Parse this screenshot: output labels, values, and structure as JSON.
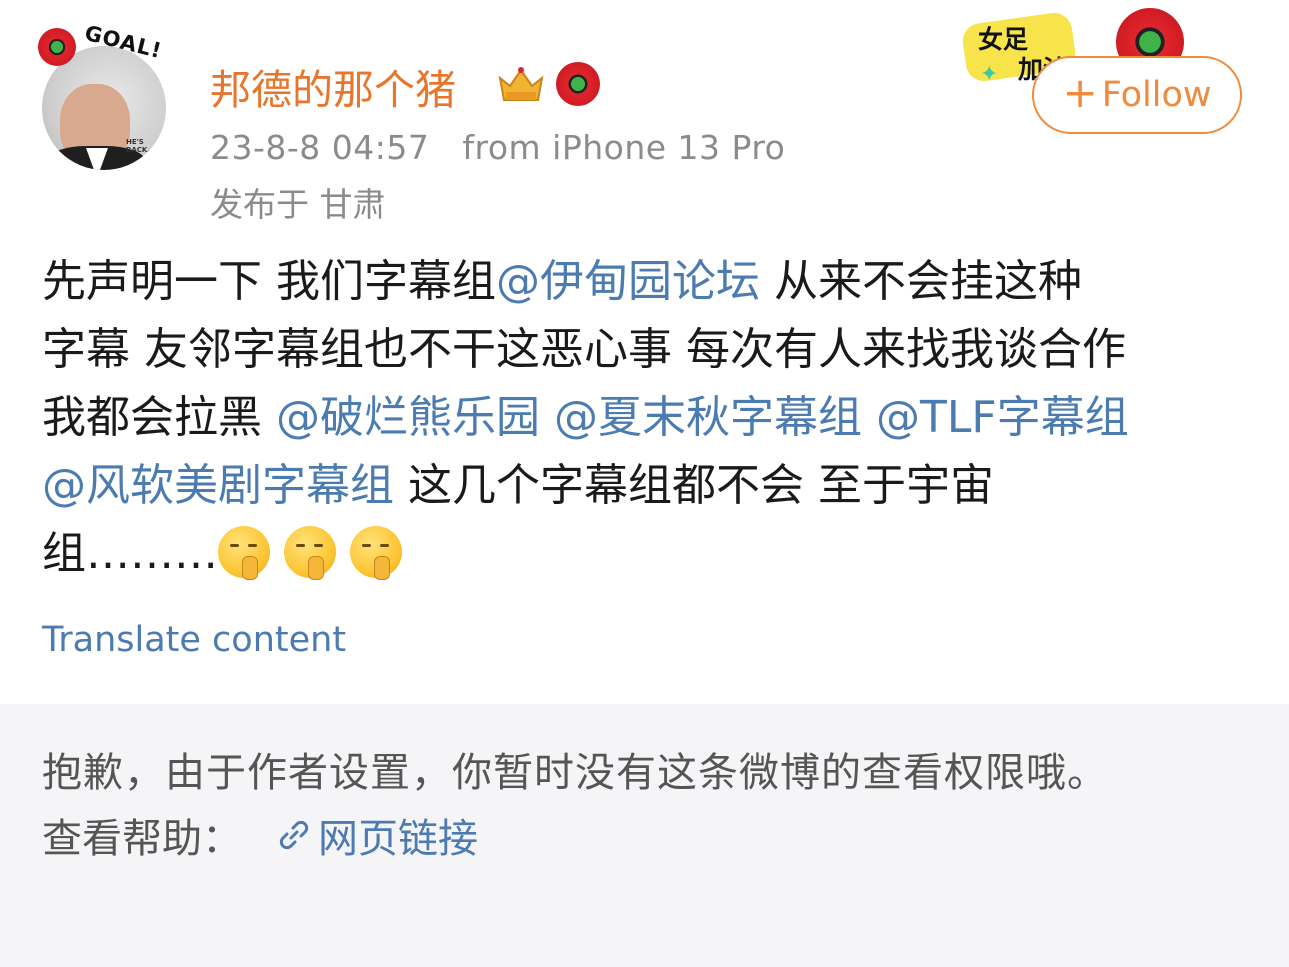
{
  "user": {
    "name": "邦德的那个猪",
    "avatar_badge_text": "GOAL!",
    "avatar_caption": "HE'S BACK.",
    "meta_time": "23-8-8 04:57",
    "meta_source": "from iPhone 13 Pro",
    "meta_location": "发布于 甘肃"
  },
  "sticker": {
    "line1": "女足",
    "line2": "加油"
  },
  "follow": {
    "plus": "+",
    "label": "Follow"
  },
  "post": {
    "lines": [
      [
        {
          "text": "先声明一下 我们字幕组"
        },
        {
          "text": "@伊甸园论坛",
          "mention": true
        },
        {
          "text": " 从来不会挂这种"
        }
      ],
      [
        {
          "text": "字幕 友邻字幕组也不干这恶心事 每次有人来找我谈合作"
        }
      ],
      [
        {
          "text": "我都会拉黑 "
        },
        {
          "text": "@破烂熊乐园",
          "mention": true
        },
        {
          "text": " "
        },
        {
          "text": "@夏末秋字幕组",
          "mention": true
        },
        {
          "text": " "
        },
        {
          "text": "@TLF字幕组",
          "mention": true
        }
      ],
      [
        {
          "text": "@风软美剧字幕组",
          "mention": true
        },
        {
          "text": " 这几个字幕组都不会 至于宇宙"
        }
      ],
      [
        {
          "text": "组………"
        }
      ]
    ],
    "emojis": [
      "shush-face-emoji",
      "shush-face-emoji",
      "shush-face-emoji"
    ],
    "translate_label": "Translate content"
  },
  "notice": {
    "message": "抱歉，由于作者设置，你暂时没有这条微博的查看权限哦。",
    "help_label": "查看帮助：",
    "link_label": "网页链接"
  },
  "colors": {
    "username": "#e8752c",
    "follow": "#f08a3c",
    "mention": "#4b7bb0",
    "meta": "#8b8b8b",
    "notice_bg": "#f5f5f7"
  }
}
